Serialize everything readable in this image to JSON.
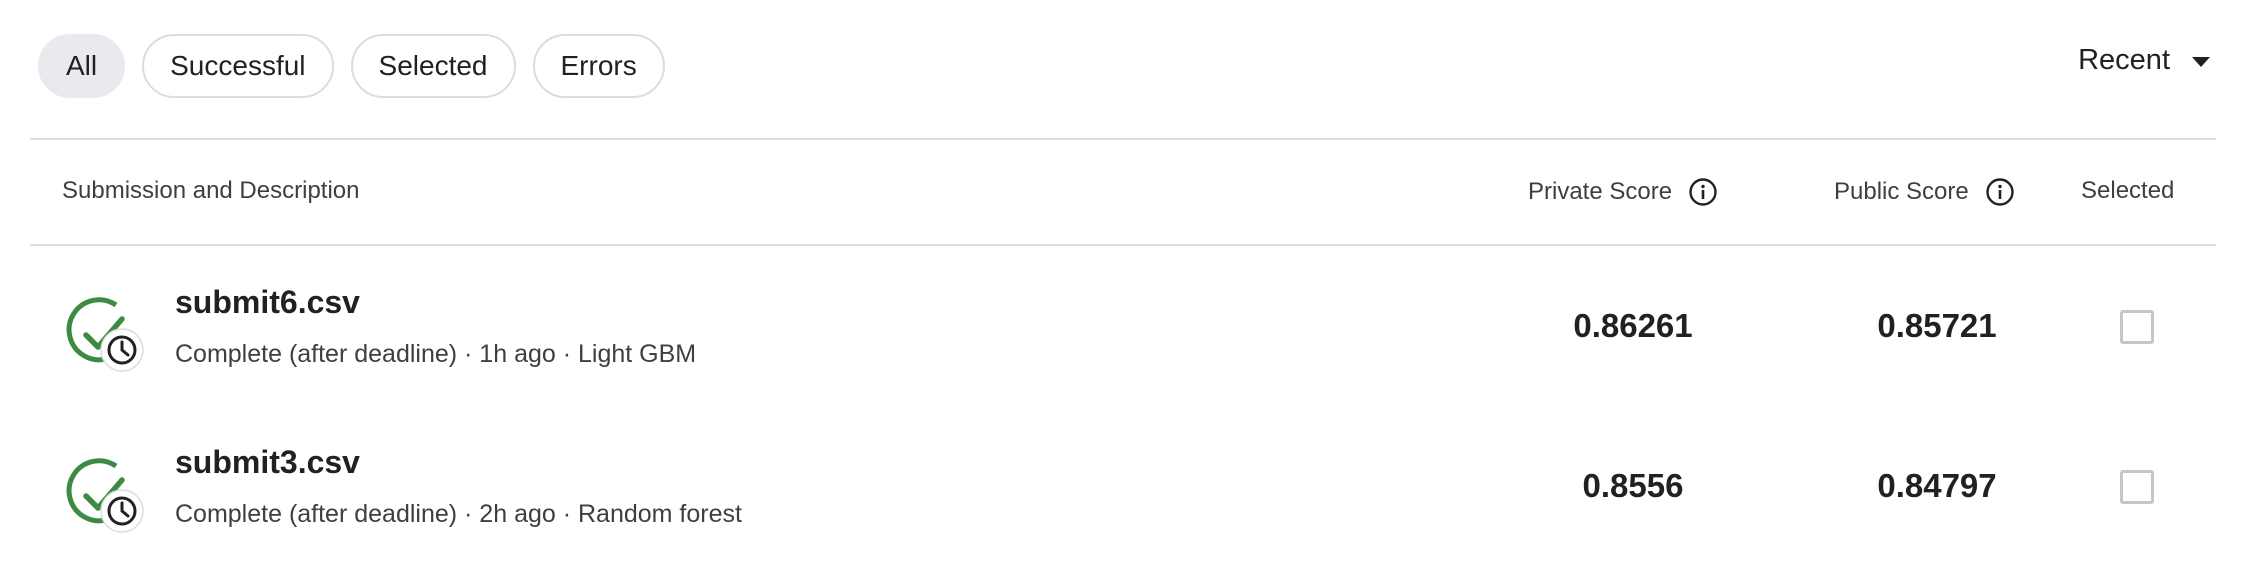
{
  "filters": [
    {
      "label": "All",
      "active": true
    },
    {
      "label": "Successful",
      "active": false
    },
    {
      "label": "Selected",
      "active": false
    },
    {
      "label": "Errors",
      "active": false
    }
  ],
  "sort": {
    "label": "Recent"
  },
  "table": {
    "headers": {
      "submission": "Submission and Description",
      "private": "Private Score",
      "public": "Public Score",
      "selected": "Selected"
    },
    "rows": [
      {
        "file": "submit6.csv",
        "description": "Complete (after deadline) · 1h ago · Light GBM",
        "private_score": "0.86261",
        "public_score": "0.85721",
        "selected": false
      },
      {
        "file": "submit3.csv",
        "description": "Complete (after deadline) · 2h ago · Random forest",
        "private_score": "0.8556",
        "public_score": "0.84797",
        "selected": false
      }
    ]
  },
  "colors": {
    "success": "#3d8a42",
    "border": "#dadce0",
    "chip_active": "#e8eaed"
  },
  "icons": {
    "status": "success-clock-icon",
    "info": "info-icon",
    "sort": "caret-down-icon"
  }
}
